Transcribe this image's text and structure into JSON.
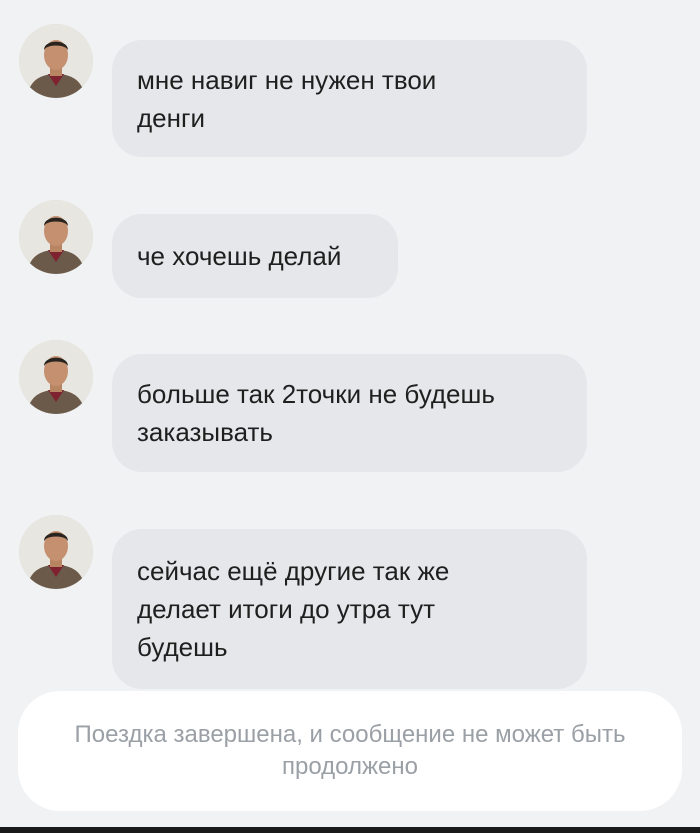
{
  "chat": {
    "messages": [
      {
        "sender_avatar": "avatar-man-photo",
        "text": "мне навиг не нужен твои\nденги"
      },
      {
        "sender_avatar": "avatar-man-photo",
        "text": "че хочешь делай"
      },
      {
        "sender_avatar": "avatar-man-photo",
        "text": "больше так 2точки не будешь\nзаказывать"
      },
      {
        "sender_avatar": "avatar-man-photo",
        "text": "сейчас ещё другие так же\nделает итоги до утра тут\nбудешь"
      }
    ],
    "notice": "Поездка завершена, и сообщение не может быть продолжено"
  },
  "colors": {
    "background": "#f1f2f4",
    "bubble": "#e6e7ea",
    "notice_bg": "#ffffff",
    "notice_text": "#9aa0a6",
    "message_text": "#1f1f1f"
  }
}
